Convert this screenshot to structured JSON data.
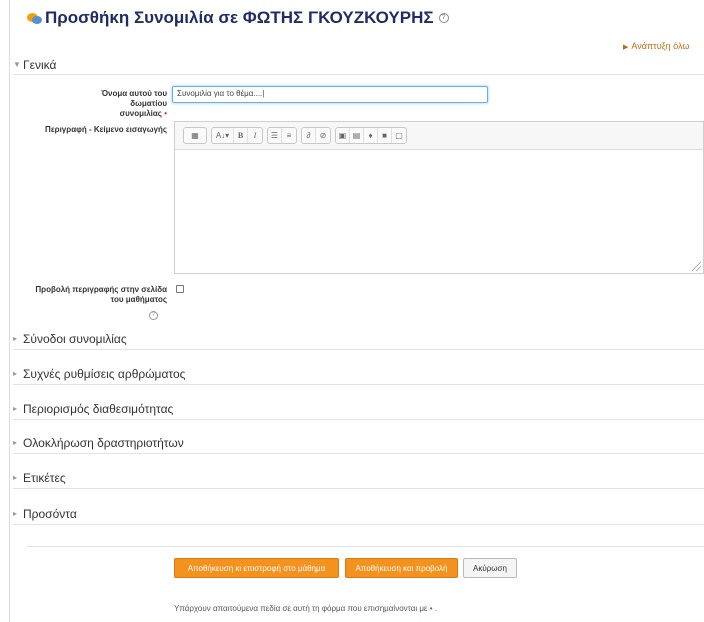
{
  "header": {
    "title": "Προσθήκη Συνομιλία σε ΦΩΤΗΣ ΓΚΟΥΖΚΟΥΡΗΣ",
    "title_icon": "chat-icon",
    "help_icon": "help-icon"
  },
  "expand_all_label": "Ανάπτυξη όλω",
  "sections": {
    "general": "Γενικά",
    "chat_sessions": "Σύνοδοι συνομιλίας",
    "common_module_settings": "Συχνές ρυθμίσεις αρθρώματος",
    "restrict_access": "Περιορισμός διαθεσιμότητας",
    "activity_completion": "Ολοκλήρωση δραστηριοτήτων",
    "tags": "Ετικέτες",
    "competencies": "Προσόντα"
  },
  "form": {
    "name_label_line1": "Όνομα αυτού του δωματίου",
    "name_label_line2": "συνομιλίας",
    "required_marker": "•",
    "name_value": "Συνομιλία για το θέμα....|",
    "description_label": "Περιγραφή - Κείμενο εισαγωγής",
    "show_description_line1": "Προβολή περιγραφής στην σελίδα",
    "show_description_line2": "του μαθήματος",
    "show_description_checked": false
  },
  "editor_toolbar": {
    "groups": [
      [
        "table-icon"
      ],
      [
        "font-style-icon",
        "bold-icon",
        "italic-icon"
      ],
      [
        "unordered-list-icon",
        "ordered-list-icon"
      ],
      [
        "link-icon",
        "unlink-icon"
      ],
      [
        "image-icon",
        "media-icon",
        "record-audio-icon",
        "record-video-icon",
        "manage-files-icon"
      ]
    ],
    "bold": "B",
    "italic": "I",
    "font_style": "A↓▾"
  },
  "buttons": {
    "save_return": "Αποθήκευση κι επιστροφή στο μάθημα",
    "save_display": "Αποθήκευση και προβολή",
    "cancel": "Ακύρωση"
  },
  "footnote": "Υπάρχουν απαιτούμενα πεδία σε αυτή τη φόρμα που επισημαίνονται με",
  "footnote_marker": "•",
  "footnote_end": ".",
  "colors": {
    "title": "#1f2d63",
    "accent_button": "#f3921f",
    "required": "#dd3333",
    "link": "#c26a16"
  }
}
